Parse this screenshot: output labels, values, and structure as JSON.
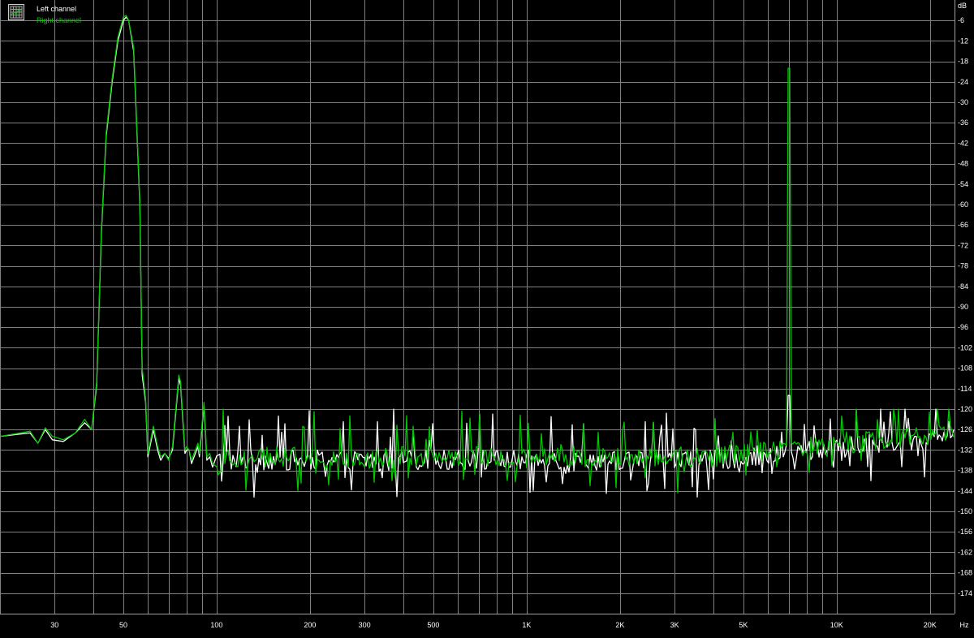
{
  "chart_data": {
    "type": "line",
    "x_scale": "log",
    "xlim": [
      20,
      24000
    ],
    "ylim": [
      -180,
      0
    ],
    "xlabel": "Hz",
    "ylabel": "dB",
    "grid": true,
    "legend_placement": "top-left",
    "x_tick_labels": [
      {
        "value": 30,
        "label": "30"
      },
      {
        "value": 50,
        "label": "50"
      },
      {
        "value": 100,
        "label": "100"
      },
      {
        "value": 200,
        "label": "200"
      },
      {
        "value": 300,
        "label": "300"
      },
      {
        "value": 500,
        "label": "500"
      },
      {
        "value": 1000,
        "label": "1K"
      },
      {
        "value": 2000,
        "label": "2K"
      },
      {
        "value": 3000,
        "label": "3K"
      },
      {
        "value": 5000,
        "label": "5K"
      },
      {
        "value": 10000,
        "label": "10K"
      },
      {
        "value": 20000,
        "label": "20K"
      }
    ],
    "x_gridlines": [
      20,
      30,
      40,
      50,
      60,
      70,
      80,
      90,
      100,
      200,
      300,
      400,
      500,
      600,
      700,
      800,
      900,
      1000,
      2000,
      3000,
      4000,
      5000,
      6000,
      7000,
      8000,
      9000,
      10000,
      20000
    ],
    "y_ticks": [
      -6,
      -12,
      -18,
      -24,
      -30,
      -36,
      -42,
      -48,
      -54,
      -60,
      -66,
      -72,
      -78,
      -84,
      -90,
      -96,
      -102,
      -108,
      -114,
      -120,
      -126,
      -132,
      -138,
      -144,
      -150,
      -156,
      -162,
      -168,
      -174
    ],
    "series": [
      {
        "name": "Left channel",
        "color": "#ffffff",
        "points": [
          [
            20,
            -128
          ],
          [
            25,
            -127
          ],
          [
            26.5,
            -130
          ],
          [
            28,
            -126
          ],
          [
            29.5,
            -129
          ],
          [
            32,
            -129.5
          ],
          [
            35,
            -127
          ],
          [
            37.5,
            -124
          ],
          [
            39.5,
            -126
          ],
          [
            41,
            -113
          ],
          [
            42.5,
            -68
          ],
          [
            44,
            -40
          ],
          [
            46,
            -24
          ],
          [
            48,
            -12
          ],
          [
            50,
            -6
          ],
          [
            51,
            -5
          ],
          [
            52,
            -6
          ],
          [
            54,
            -15
          ],
          [
            56.5,
            -60
          ],
          [
            57.5,
            -110
          ],
          [
            59,
            -118
          ],
          [
            60,
            -134
          ],
          [
            62.5,
            -126
          ],
          [
            64.5,
            -132
          ],
          [
            66,
            -135
          ],
          [
            68,
            -133
          ],
          [
            70,
            -134.5
          ],
          [
            72,
            -132
          ],
          [
            75.5,
            -111
          ],
          [
            76.5,
            -113
          ],
          [
            79,
            -133
          ],
          [
            80,
            -132
          ],
          [
            81.5,
            -132
          ],
          [
            83,
            -136
          ],
          [
            87,
            -131
          ],
          [
            88,
            -134
          ],
          [
            91,
            -119
          ],
          [
            93,
            -135
          ],
          [
            95,
            -134
          ],
          [
            97,
            -137
          ]
        ],
        "noise_floor_db": -135,
        "noise_range": [
          100,
          24000
        ],
        "peaks": [
          {
            "x": 7000,
            "y": -116
          }
        ]
      },
      {
        "name": "Right channel",
        "color": "#00c800",
        "points": [
          [
            20,
            -128
          ],
          [
            25,
            -126.5
          ],
          [
            26.5,
            -130
          ],
          [
            28,
            -125.5
          ],
          [
            29.5,
            -128
          ],
          [
            32,
            -129
          ],
          [
            35,
            -127
          ],
          [
            37.5,
            -123
          ],
          [
            39.5,
            -126
          ],
          [
            41,
            -112
          ],
          [
            42.5,
            -67
          ],
          [
            44,
            -39
          ],
          [
            46,
            -23
          ],
          [
            48,
            -11
          ],
          [
            50,
            -5
          ],
          [
            51,
            -4.5
          ],
          [
            52,
            -6
          ],
          [
            54,
            -14
          ],
          [
            56.5,
            -59
          ],
          [
            57.5,
            -108
          ],
          [
            59,
            -117
          ],
          [
            60,
            -133
          ],
          [
            62.5,
            -125
          ],
          [
            64.5,
            -131
          ],
          [
            66,
            -134
          ],
          [
            68,
            -133
          ],
          [
            70,
            -135
          ],
          [
            72,
            -131
          ],
          [
            75.5,
            -110
          ],
          [
            76.5,
            -112
          ],
          [
            79,
            -132
          ],
          [
            80,
            -131
          ],
          [
            81.5,
            -132
          ],
          [
            83,
            -135
          ],
          [
            87,
            -130
          ],
          [
            88,
            -133
          ],
          [
            91,
            -118
          ],
          [
            93,
            -134
          ],
          [
            95,
            -133
          ],
          [
            97,
            -136
          ]
        ],
        "noise_floor_db": -134,
        "noise_range": [
          100,
          24000
        ],
        "peaks": [
          {
            "x": 7000,
            "y": -20
          }
        ]
      }
    ]
  },
  "colors": {
    "background": "#000000",
    "grid": "#808080",
    "axis_text": "#ffffff",
    "left_channel": "#ffffff",
    "right_channel": "#00c800"
  },
  "legend": {
    "icon": "grid-icon",
    "entries": [
      {
        "label": "Left channel",
        "color": "#ffffff"
      },
      {
        "label": "Right channel",
        "color": "#00c800"
      }
    ]
  }
}
